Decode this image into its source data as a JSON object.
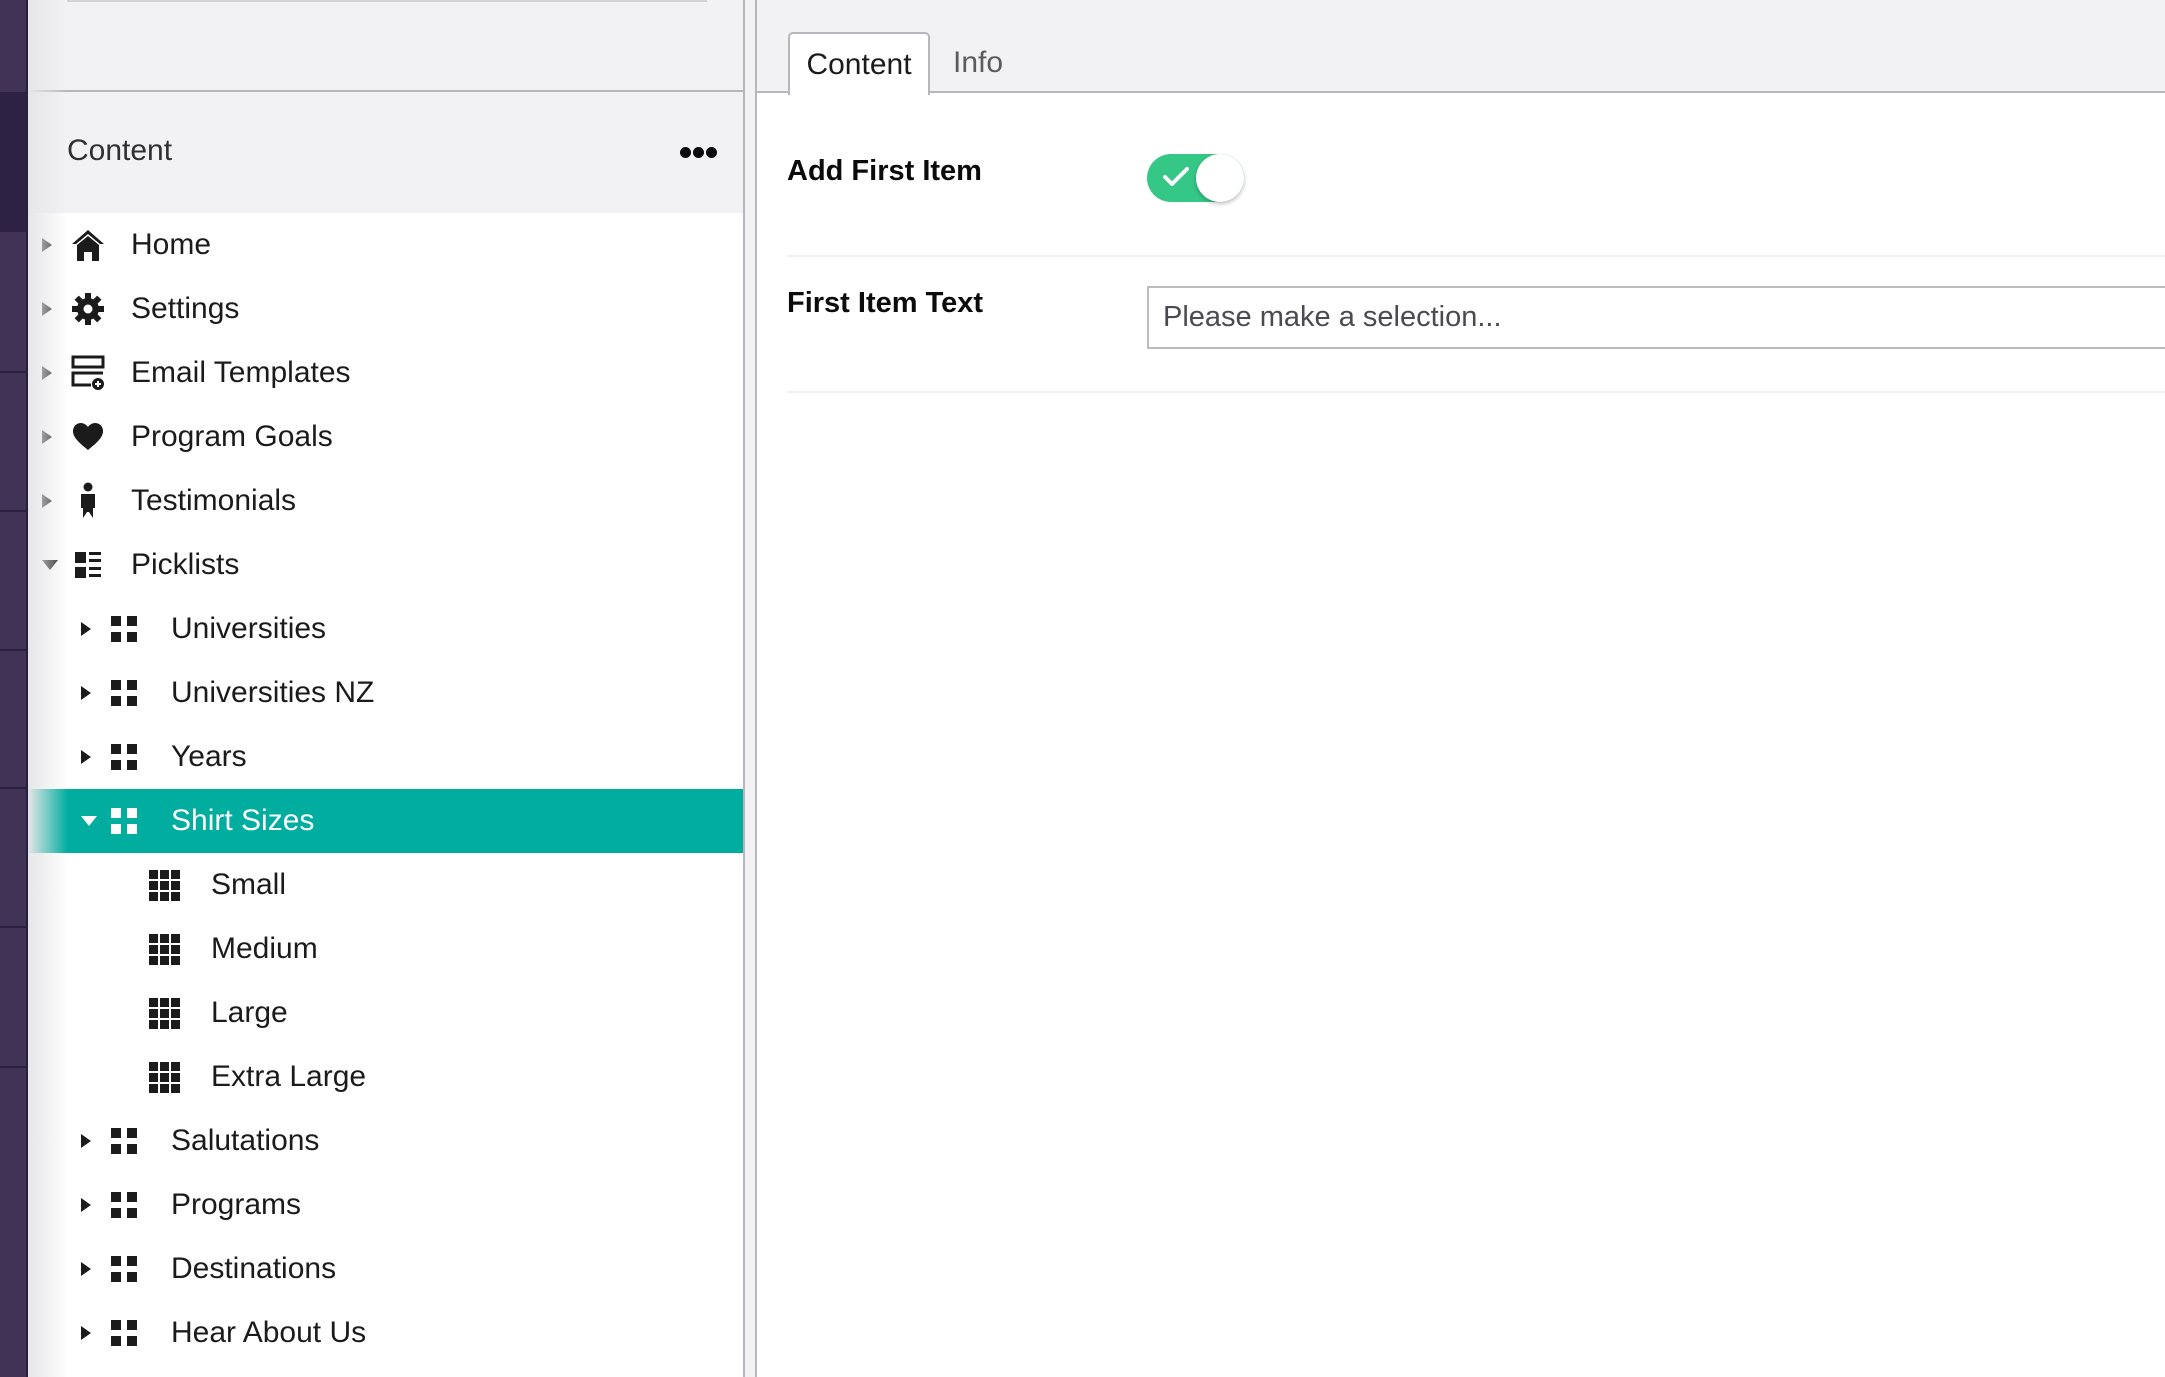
{
  "tree": {
    "title": "Content",
    "menu_icon": "ellipsis-icon",
    "search_placeholder": "",
    "items": [
      {
        "label": "Home",
        "icon": "home-icon",
        "level": 0,
        "expanded": false,
        "has_children": true
      },
      {
        "label": "Settings",
        "icon": "gear-icon",
        "level": 0,
        "expanded": false,
        "has_children": true
      },
      {
        "label": "Email Templates",
        "icon": "email-template-icon",
        "level": 0,
        "expanded": false,
        "has_children": true
      },
      {
        "label": "Program Goals",
        "icon": "heart-icon",
        "level": 0,
        "expanded": false,
        "has_children": true
      },
      {
        "label": "Testimonials",
        "icon": "person-icon",
        "level": 0,
        "expanded": false,
        "has_children": true
      },
      {
        "label": "Picklists",
        "icon": "picklist-icon",
        "level": 0,
        "expanded": true,
        "has_children": true
      },
      {
        "label": "Universities",
        "icon": "grid-four-icon",
        "level": 1,
        "expanded": false,
        "has_children": true
      },
      {
        "label": "Universities NZ",
        "icon": "grid-four-icon",
        "level": 1,
        "expanded": false,
        "has_children": true
      },
      {
        "label": "Years",
        "icon": "grid-four-icon",
        "level": 1,
        "expanded": false,
        "has_children": true
      },
      {
        "label": "Shirt Sizes",
        "icon": "grid-four-icon",
        "level": 1,
        "expanded": true,
        "has_children": true,
        "selected": true
      },
      {
        "label": "Small",
        "icon": "grid-nine-icon",
        "level": 2,
        "has_children": false
      },
      {
        "label": "Medium",
        "icon": "grid-nine-icon",
        "level": 2,
        "has_children": false
      },
      {
        "label": "Large",
        "icon": "grid-nine-icon",
        "level": 2,
        "has_children": false
      },
      {
        "label": "Extra Large",
        "icon": "grid-nine-icon",
        "level": 2,
        "has_children": false
      },
      {
        "label": "Salutations",
        "icon": "grid-four-icon",
        "level": 1,
        "expanded": false,
        "has_children": true
      },
      {
        "label": "Programs",
        "icon": "grid-four-icon",
        "level": 1,
        "expanded": false,
        "has_children": true
      },
      {
        "label": "Destinations",
        "icon": "grid-four-icon",
        "level": 1,
        "expanded": false,
        "has_children": true
      },
      {
        "label": "Hear About Us",
        "icon": "grid-four-icon",
        "level": 1,
        "expanded": false,
        "has_children": true
      }
    ]
  },
  "editor": {
    "tabs": [
      {
        "label": "Content",
        "active": true
      },
      {
        "label": "Info",
        "active": false
      }
    ],
    "properties": {
      "add_first_item": {
        "label": "Add First Item",
        "value": true
      },
      "first_item_text": {
        "label": "First Item Text",
        "placeholder": "Please make a selection...",
        "value": ""
      }
    }
  },
  "colors": {
    "selected_row": "#00ad9f",
    "toggle_on": "#35c786",
    "app_strip": "#413355",
    "app_strip_active": "#2d2244"
  }
}
